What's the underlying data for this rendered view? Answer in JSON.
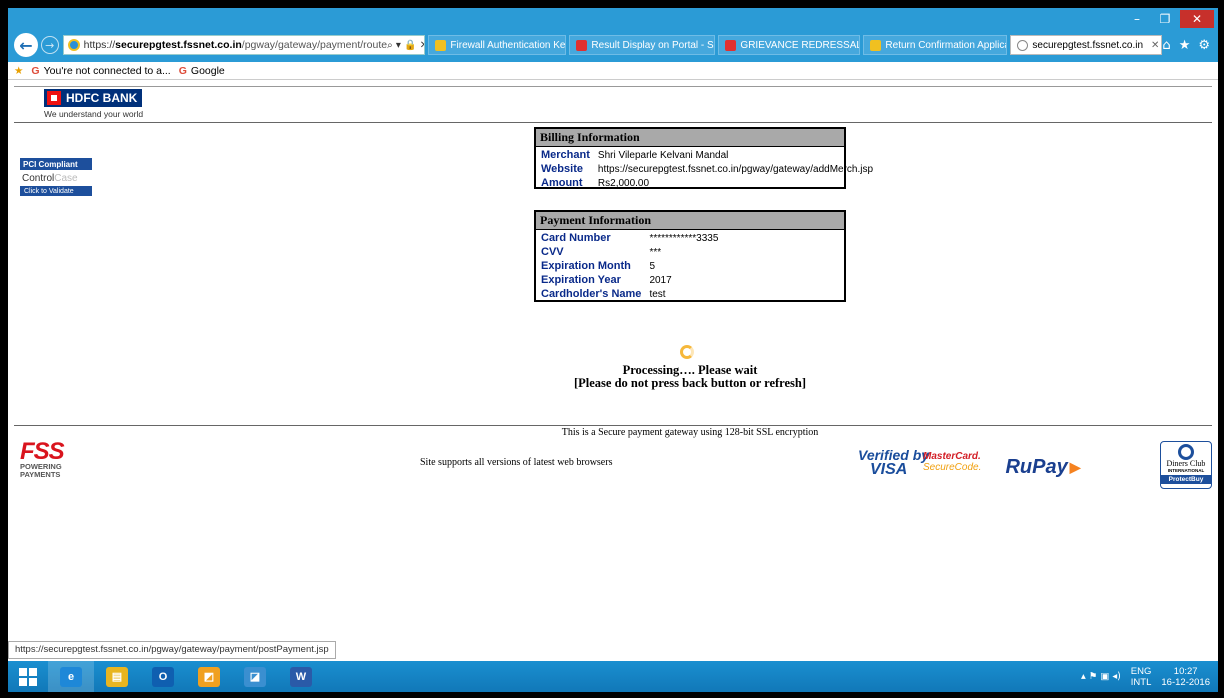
{
  "browser": {
    "window_controls": {
      "minimize": "–",
      "restore": "❐",
      "close": "✕"
    },
    "nav": {
      "back_icon": "←",
      "forward_icon": "→"
    },
    "address": {
      "proto": "https://",
      "domain": "securepgtest.fssnet.co.in",
      "path": "/pgway/gateway/payment/route",
      "icons": "⌕ ▾ 🔒 ✕"
    },
    "tabs": [
      {
        "label": "Firewall Authentication Keepa...",
        "icon_color": "#f0c020"
      },
      {
        "label": "Result Display on Portal - SAP...",
        "icon_color": "#e03030"
      },
      {
        "label": "GRIEVANCE REDRESSAL",
        "icon_color": "#e03030"
      },
      {
        "label": "Return Confirmation Applicat...",
        "icon_color": "#f0c020"
      },
      {
        "label": "securepgtest.fssnet.co.in",
        "icon_color": "#ffffff",
        "active": true,
        "close": "✕"
      }
    ],
    "right_icons": {
      "home": "⌂",
      "star": "★",
      "gear": "⚙"
    },
    "favorites": [
      {
        "icon": "G",
        "label": "You're not connected to a..."
      },
      {
        "icon": "G",
        "label": "Google"
      }
    ],
    "status_url": "https://securepgtest.fssnet.co.in/pgway/gateway/payment/postPayment.jsp"
  },
  "header": {
    "bank_name": "HDFC BANK",
    "tagline": "We understand your world"
  },
  "pci": {
    "top": "PCI Compliant",
    "mid_a": "Control",
    "mid_b": "Case",
    "bottom": "Click to Validate"
  },
  "billing": {
    "title": "Billing Information",
    "rows": [
      {
        "label": "Merchant",
        "value": "Shri Vileparle Kelvani Mandal"
      },
      {
        "label": "Website",
        "value": "https://securepgtest.fssnet.co.in/pgway/gateway/addMerch.jsp"
      },
      {
        "label": "Amount",
        "value": "Rs2,000.00"
      }
    ]
  },
  "payment": {
    "title": "Payment Information",
    "rows": [
      {
        "label": "Card Number",
        "value": "************3335"
      },
      {
        "label": "CVV",
        "value": "***"
      },
      {
        "label": "Expiration Month",
        "value": "5"
      },
      {
        "label": "Expiration Year",
        "value": "2017"
      },
      {
        "label": "Cardholder's Name",
        "value": "test"
      }
    ]
  },
  "processing": {
    "line1": "Processing…. Please wait",
    "line2": "[Please do not press back button or refresh]"
  },
  "footer": {
    "ssl": "This is a Secure payment gateway using 128-bit SSL encryption",
    "browsers": "Site supports all versions of latest web browsers",
    "fss": {
      "big": "FSS",
      "line1": "POWERING",
      "line2": "PAYMENTS"
    },
    "visa": {
      "by": "Verified by",
      "name": "VISA"
    },
    "mastercard": {
      "a": "MasterCard.",
      "b": "SecureCode."
    },
    "rupay": "RuPay",
    "diners": {
      "name": "Diners Club",
      "intl": "INTERNATIONAL",
      "protect": "ProtectBuy"
    }
  },
  "taskbar": {
    "apps": [
      {
        "name": "ie",
        "glyph": "e",
        "color": "#1e88d8",
        "active": true
      },
      {
        "name": "explorer",
        "glyph": "▤",
        "color": "#e8b520"
      },
      {
        "name": "outlook",
        "glyph": "O",
        "color": "#0f5fb0"
      },
      {
        "name": "app4",
        "glyph": "◩",
        "color": "#f0a020"
      },
      {
        "name": "app5",
        "glyph": "◪",
        "color": "#3a8fd0"
      },
      {
        "name": "word",
        "glyph": "W",
        "color": "#2a5aa8"
      }
    ],
    "tray_icons": "▴  ⚑  ▣  ◂)",
    "lang_1": "ENG",
    "lang_2": "INTL",
    "time": "10:27",
    "date": "16-12-2016"
  }
}
